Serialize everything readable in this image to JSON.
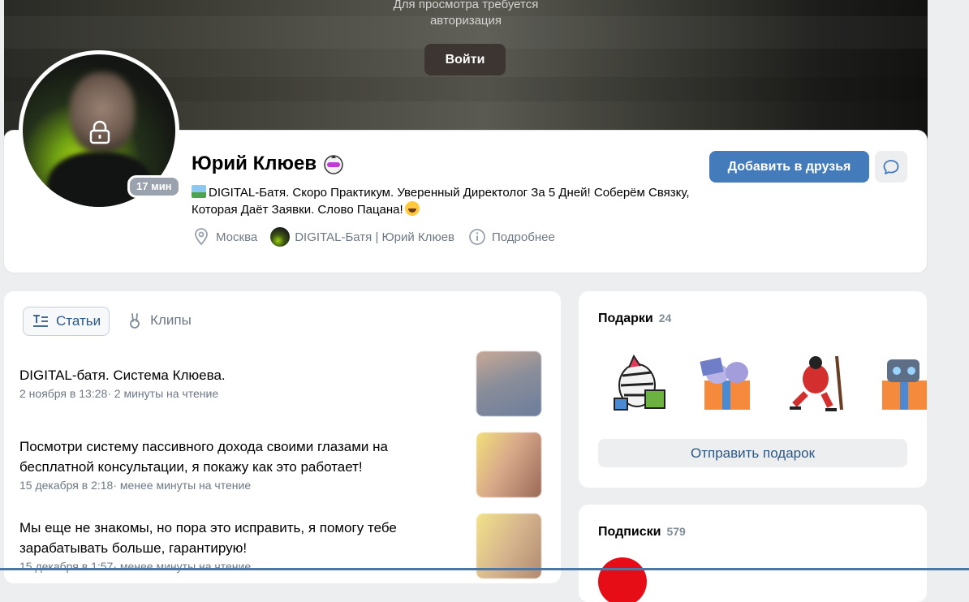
{
  "cover": {
    "auth_text_line1": "Для просмотра требуется",
    "auth_text_line2": "авторизация",
    "login_button": "Войти"
  },
  "profile": {
    "name": "Юрий Клюев",
    "online": "17 мин",
    "status": "DIGITAL-Батя. Скоро Практикум. Уверенный Директолог За 5 Дней! Соберём Связку, Которая Даёт Заявки. Слово Пацана!",
    "city": "Москва",
    "community": "DIGITAL-Батя | Юрий Клюев",
    "more": "Подробнее",
    "add_friend_button": "Добавить в друзья"
  },
  "content_tabs": [
    {
      "label": "Статьи",
      "icon": "articles-icon",
      "active": true
    },
    {
      "label": "Клипы",
      "icon": "clips-icon",
      "active": false
    }
  ],
  "articles": [
    {
      "title": "DIGITAL-батя. Система Клюева.",
      "meta": "2 ноября в 13:28· 2 минуты на чтение"
    },
    {
      "title": "Посмотри систему пассивного дохода своими глазами на бесплатной консультации, я покажу как это работает!",
      "meta": "15 декабря в 2:18· менее минуты на чтение"
    },
    {
      "title": "Мы еще не знакомы, но пора это исправить, я помогу тебе зарабатывать больше, гарантирую!",
      "meta": "15 декабря в 1:57· менее минуты на чтение"
    }
  ],
  "gifts": {
    "title": "Подарки",
    "count": "24",
    "send_button": "Отправить подарок",
    "items": [
      "zebra-gift",
      "cats-box-gift",
      "hockey-player-gift",
      "robot-box-gift"
    ]
  },
  "subscriptions": {
    "title": "Подписки",
    "count": "579"
  },
  "colors": {
    "accent": "#447bba",
    "link": "#2a5885",
    "secondary_text": "#6d7885",
    "background": "#edeef0"
  }
}
